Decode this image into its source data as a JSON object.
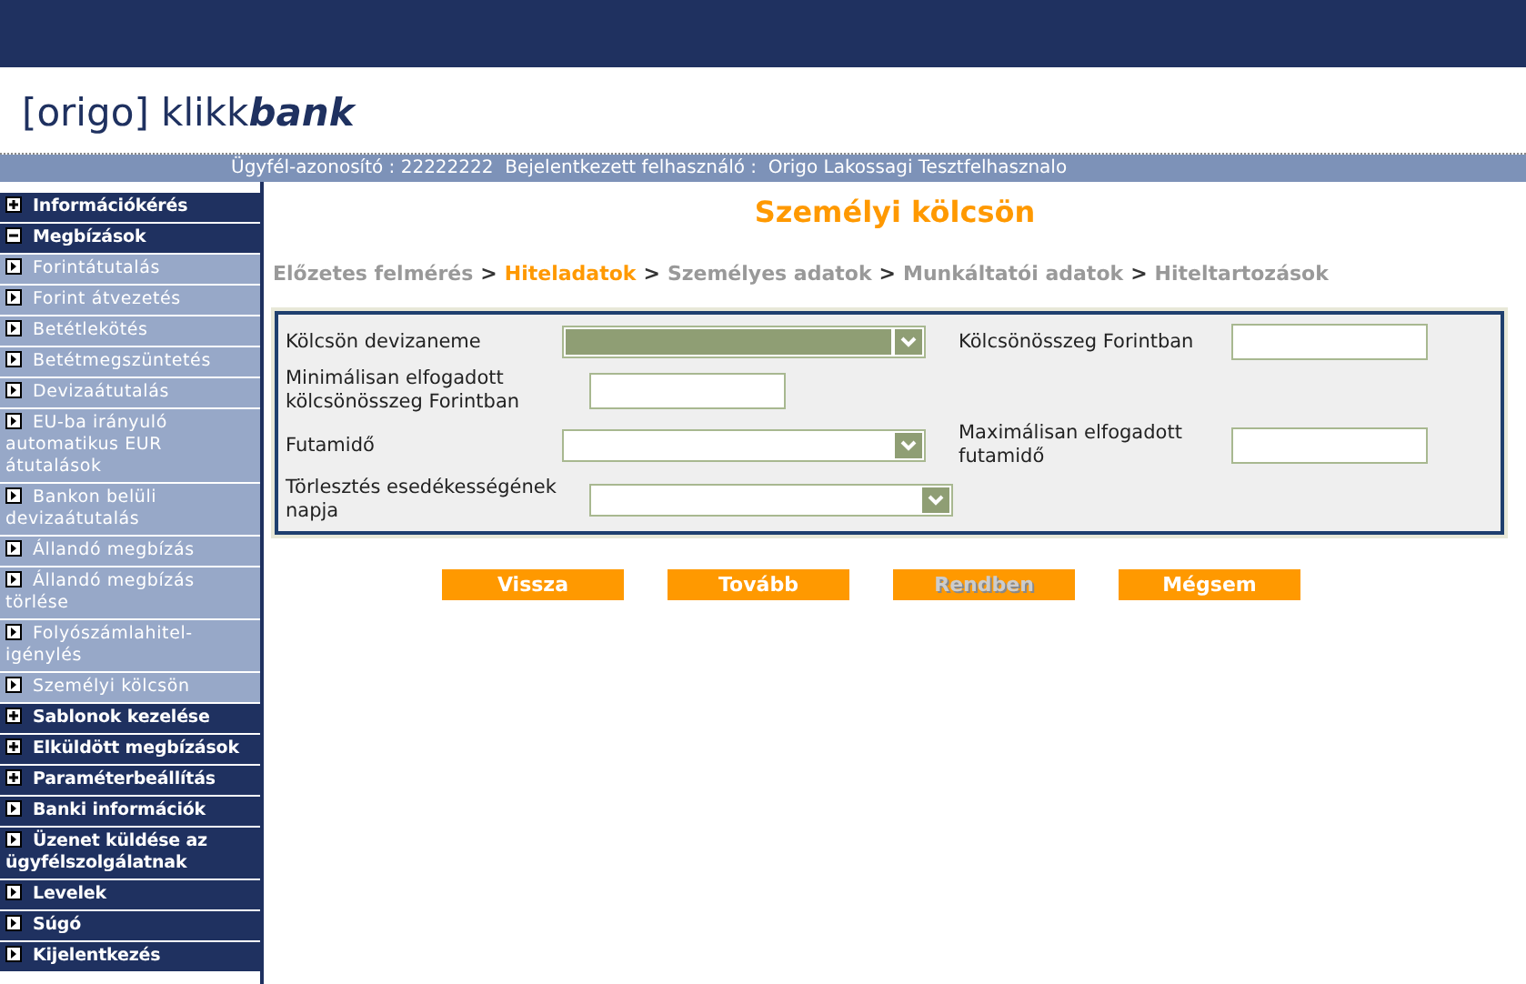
{
  "header": {
    "logo_prefix": "[origo] klikk",
    "logo_suffix": "bank"
  },
  "info_bar": "Ügyfél-azonosító : 22222222  Bejelentkezett felhasználó :  Origo Lakossagi Tesztfelhasznalo",
  "sidebar": {
    "items": [
      {
        "label": "Információkérés",
        "kind": "group",
        "expanded": false
      },
      {
        "label": "Megbízások",
        "kind": "group",
        "expanded": true,
        "children": [
          {
            "label": "Forintátutalás",
            "kind": "link"
          },
          {
            "label": "Forint átvezetés",
            "kind": "link"
          },
          {
            "label": "Betétlekötés",
            "kind": "link"
          },
          {
            "label": "Betétmegszüntetés",
            "kind": "link"
          },
          {
            "label": "Devizaátutalás",
            "kind": "link"
          },
          {
            "label": "EU-ba irányuló automatikus EUR átutalások",
            "kind": "link"
          },
          {
            "label": "Bankon belüli devizaátutalás",
            "kind": "link"
          },
          {
            "label": "Állandó megbízás",
            "kind": "link"
          },
          {
            "label": "Állandó megbízás törlése",
            "kind": "link"
          },
          {
            "label": "Folyószámlahitel-igénylés",
            "kind": "link"
          },
          {
            "label": "Személyi kölcsön",
            "kind": "link"
          }
        ]
      },
      {
        "label": "Sablonok kezelése",
        "kind": "group",
        "expanded": false
      },
      {
        "label": "Elküldött megbízások",
        "kind": "group",
        "expanded": false
      },
      {
        "label": "Paraméterbeállítás",
        "kind": "group",
        "expanded": false
      },
      {
        "label": "Banki információk",
        "kind": "link"
      },
      {
        "label": "Üzenet küldése az ügyfélszolgálatnak",
        "kind": "link"
      },
      {
        "label": "Levelek",
        "kind": "link"
      },
      {
        "label": "Súgó",
        "kind": "link"
      },
      {
        "label": "Kijelentkezés",
        "kind": "link"
      }
    ]
  },
  "page_title": "Személyi kölcsön",
  "steps": [
    {
      "label": "Előzetes felmérés",
      "selected": false
    },
    {
      "label": "Hiteladatok",
      "selected": true
    },
    {
      "label": "Személyes adatok",
      "selected": false
    },
    {
      "label": "Munkáltatói adatok",
      "selected": false
    },
    {
      "label": "Hiteltartozások",
      "selected": false
    }
  ],
  "step_separator": ">",
  "form": {
    "rows": [
      [
        {
          "label": "Kölcsön devizaneme",
          "kind": "select",
          "highlighted": true
        },
        {
          "label": "Kölcsönösszeg Forintban",
          "kind": "input"
        }
      ],
      [
        {
          "label": "Minimálisan elfogadott kölcsönösszeg Forintban",
          "kind": "input"
        }
      ],
      [
        {
          "label": "Futamidő",
          "kind": "select",
          "highlighted": false
        },
        {
          "label": "Maximálisan elfogadott futamidő",
          "kind": "input"
        }
      ],
      [
        {
          "label": "Törlesztés esedékességének napja",
          "kind": "select",
          "highlighted": false
        }
      ]
    ]
  },
  "buttons": [
    {
      "label": "Vissza",
      "disabled": false
    },
    {
      "label": "Tovább",
      "disabled": false
    },
    {
      "label": "Rendben",
      "disabled": true
    },
    {
      "label": "Mégsem",
      "disabled": false
    }
  ]
}
